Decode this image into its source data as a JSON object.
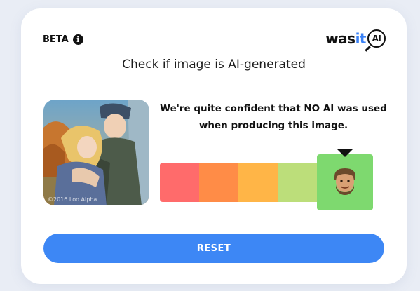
{
  "header": {
    "beta_label": "BETA",
    "info_icon": "info-icon",
    "logo_text_main": "was",
    "logo_text_accent": "it",
    "logo_badge": "AI"
  },
  "subtitle": "Check if image is AI-generated",
  "result": {
    "verdict_line1": "We're quite confident that NO AI was used",
    "verdict_line2": "when producing this image.",
    "selected_level": 5,
    "level_count": 5,
    "selected_icon": "person-emoji-icon"
  },
  "image": {
    "caption": "©2016 Loo Alpha"
  },
  "colors": {
    "level_1": "#ff6b6b",
    "level_2": "#ff8c47",
    "level_3": "#ffb547",
    "level_4": "#bcde7a",
    "level_5": "#7ed96f",
    "accent": "#3d87f5"
  },
  "actions": {
    "reset_label": "RESET"
  }
}
